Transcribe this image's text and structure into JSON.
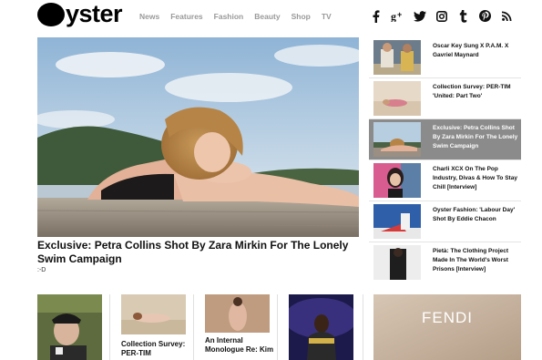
{
  "header": {
    "logo": "yster",
    "nav": [
      "News",
      "Features",
      "Fashion",
      "Beauty",
      "Shop",
      "TV"
    ],
    "social": [
      "facebook-icon",
      "google-plus-icon",
      "twitter-icon",
      "instagram-icon",
      "tumblr-icon",
      "pinterest-icon",
      "rss-icon"
    ]
  },
  "hero": {
    "title": "Exclusive: Petra Collins Shot By Zara Mirkin For The Lonely Swim Campaign",
    "subtitle": ":-D"
  },
  "sidebar": {
    "items": [
      {
        "title": "Oscar Key Sung X P.A.M. X Gavriel Maynard",
        "active": false
      },
      {
        "title": "Collection Survey: PER-TIM 'United: Part Two'",
        "active": false
      },
      {
        "title": "Exclusive: Petra Collins Shot By Zara Mirkin For The Lonely Swim Campaign",
        "active": true
      },
      {
        "title": "Charli XCX On The Pop Industry, Divas & How To Stay Chill [Interview]",
        "active": false
      },
      {
        "title": "Oyster Fashion: 'Labour Day' Shot By Eddie Chacon",
        "active": false
      },
      {
        "title": "Pietà: The Clothing Project Made In The World's Worst Prisons [Interview]",
        "active": false
      }
    ]
  },
  "cards": [
    {
      "title": ""
    },
    {
      "title": "Collection Survey: PER-TIM"
    },
    {
      "title": "An Internal Monologue Re: Kim"
    },
    {
      "title": ""
    }
  ],
  "ad": {
    "brand": "FENDI"
  },
  "colors": {
    "nav_grey": "#9a9a9a",
    "active_row": "#8b8b8b",
    "text": "#111111"
  }
}
